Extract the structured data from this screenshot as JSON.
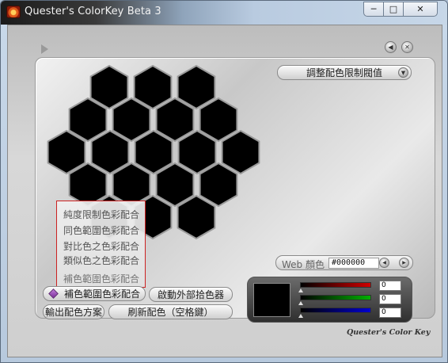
{
  "window": {
    "title": "Quester's ColorKey Beta 3",
    "controls": {
      "minimize": "─",
      "maximize": "□",
      "close": "✕"
    }
  },
  "panel": {
    "threshold_button": "調整配色限制閥值",
    "nav": {
      "back": "◀",
      "close": "✕"
    }
  },
  "hexagons": {
    "fill": "#000000",
    "count": 19
  },
  "scheme_menu": {
    "items": [
      "純度限制色彩配合",
      "同色範圍色彩配合",
      "對比色之色彩配合",
      "類似色之色彩配合",
      "補色範圍色彩配合"
    ],
    "selected": "補色範圍色彩配合"
  },
  "buttons": {
    "complement": "補色範圍色彩配合",
    "external_picker": "啟動外部拾色器",
    "export": "輸出配色方案",
    "refresh": "刷新配色（空格鍵）"
  },
  "web_color": {
    "label": "Web 顏色",
    "value": "#000000"
  },
  "rgb": {
    "r": "0",
    "g": "0",
    "b": "0",
    "colors": {
      "r": "#d00000",
      "g": "#00b000",
      "b": "#0000d0"
    }
  },
  "brand": "Quester's Color Key"
}
